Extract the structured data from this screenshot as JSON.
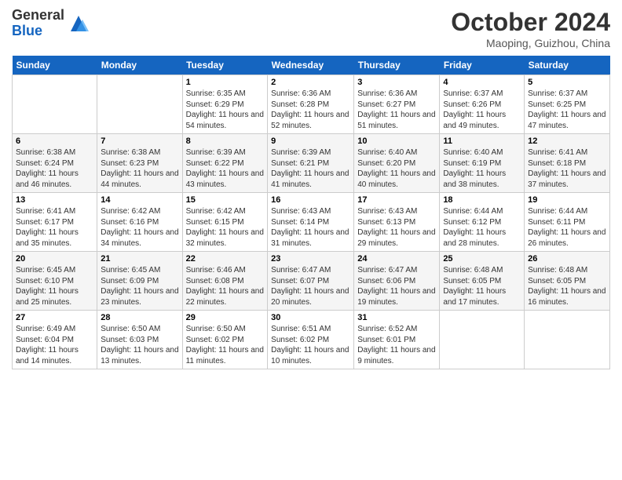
{
  "logo": {
    "general": "General",
    "blue": "Blue"
  },
  "header": {
    "month": "October 2024",
    "location": "Maoping, Guizhou, China"
  },
  "weekdays": [
    "Sunday",
    "Monday",
    "Tuesday",
    "Wednesday",
    "Thursday",
    "Friday",
    "Saturday"
  ],
  "weeks": [
    [
      {
        "day": "",
        "info": ""
      },
      {
        "day": "",
        "info": ""
      },
      {
        "day": "1",
        "info": "Sunrise: 6:35 AM\nSunset: 6:29 PM\nDaylight: 11 hours and 54 minutes."
      },
      {
        "day": "2",
        "info": "Sunrise: 6:36 AM\nSunset: 6:28 PM\nDaylight: 11 hours and 52 minutes."
      },
      {
        "day": "3",
        "info": "Sunrise: 6:36 AM\nSunset: 6:27 PM\nDaylight: 11 hours and 51 minutes."
      },
      {
        "day": "4",
        "info": "Sunrise: 6:37 AM\nSunset: 6:26 PM\nDaylight: 11 hours and 49 minutes."
      },
      {
        "day": "5",
        "info": "Sunrise: 6:37 AM\nSunset: 6:25 PM\nDaylight: 11 hours and 47 minutes."
      }
    ],
    [
      {
        "day": "6",
        "info": "Sunrise: 6:38 AM\nSunset: 6:24 PM\nDaylight: 11 hours and 46 minutes."
      },
      {
        "day": "7",
        "info": "Sunrise: 6:38 AM\nSunset: 6:23 PM\nDaylight: 11 hours and 44 minutes."
      },
      {
        "day": "8",
        "info": "Sunrise: 6:39 AM\nSunset: 6:22 PM\nDaylight: 11 hours and 43 minutes."
      },
      {
        "day": "9",
        "info": "Sunrise: 6:39 AM\nSunset: 6:21 PM\nDaylight: 11 hours and 41 minutes."
      },
      {
        "day": "10",
        "info": "Sunrise: 6:40 AM\nSunset: 6:20 PM\nDaylight: 11 hours and 40 minutes."
      },
      {
        "day": "11",
        "info": "Sunrise: 6:40 AM\nSunset: 6:19 PM\nDaylight: 11 hours and 38 minutes."
      },
      {
        "day": "12",
        "info": "Sunrise: 6:41 AM\nSunset: 6:18 PM\nDaylight: 11 hours and 37 minutes."
      }
    ],
    [
      {
        "day": "13",
        "info": "Sunrise: 6:41 AM\nSunset: 6:17 PM\nDaylight: 11 hours and 35 minutes."
      },
      {
        "day": "14",
        "info": "Sunrise: 6:42 AM\nSunset: 6:16 PM\nDaylight: 11 hours and 34 minutes."
      },
      {
        "day": "15",
        "info": "Sunrise: 6:42 AM\nSunset: 6:15 PM\nDaylight: 11 hours and 32 minutes."
      },
      {
        "day": "16",
        "info": "Sunrise: 6:43 AM\nSunset: 6:14 PM\nDaylight: 11 hours and 31 minutes."
      },
      {
        "day": "17",
        "info": "Sunrise: 6:43 AM\nSunset: 6:13 PM\nDaylight: 11 hours and 29 minutes."
      },
      {
        "day": "18",
        "info": "Sunrise: 6:44 AM\nSunset: 6:12 PM\nDaylight: 11 hours and 28 minutes."
      },
      {
        "day": "19",
        "info": "Sunrise: 6:44 AM\nSunset: 6:11 PM\nDaylight: 11 hours and 26 minutes."
      }
    ],
    [
      {
        "day": "20",
        "info": "Sunrise: 6:45 AM\nSunset: 6:10 PM\nDaylight: 11 hours and 25 minutes."
      },
      {
        "day": "21",
        "info": "Sunrise: 6:45 AM\nSunset: 6:09 PM\nDaylight: 11 hours and 23 minutes."
      },
      {
        "day": "22",
        "info": "Sunrise: 6:46 AM\nSunset: 6:08 PM\nDaylight: 11 hours and 22 minutes."
      },
      {
        "day": "23",
        "info": "Sunrise: 6:47 AM\nSunset: 6:07 PM\nDaylight: 11 hours and 20 minutes."
      },
      {
        "day": "24",
        "info": "Sunrise: 6:47 AM\nSunset: 6:06 PM\nDaylight: 11 hours and 19 minutes."
      },
      {
        "day": "25",
        "info": "Sunrise: 6:48 AM\nSunset: 6:05 PM\nDaylight: 11 hours and 17 minutes."
      },
      {
        "day": "26",
        "info": "Sunrise: 6:48 AM\nSunset: 6:05 PM\nDaylight: 11 hours and 16 minutes."
      }
    ],
    [
      {
        "day": "27",
        "info": "Sunrise: 6:49 AM\nSunset: 6:04 PM\nDaylight: 11 hours and 14 minutes."
      },
      {
        "day": "28",
        "info": "Sunrise: 6:50 AM\nSunset: 6:03 PM\nDaylight: 11 hours and 13 minutes."
      },
      {
        "day": "29",
        "info": "Sunrise: 6:50 AM\nSunset: 6:02 PM\nDaylight: 11 hours and 11 minutes."
      },
      {
        "day": "30",
        "info": "Sunrise: 6:51 AM\nSunset: 6:02 PM\nDaylight: 11 hours and 10 minutes."
      },
      {
        "day": "31",
        "info": "Sunrise: 6:52 AM\nSunset: 6:01 PM\nDaylight: 11 hours and 9 minutes."
      },
      {
        "day": "",
        "info": ""
      },
      {
        "day": "",
        "info": ""
      }
    ]
  ]
}
